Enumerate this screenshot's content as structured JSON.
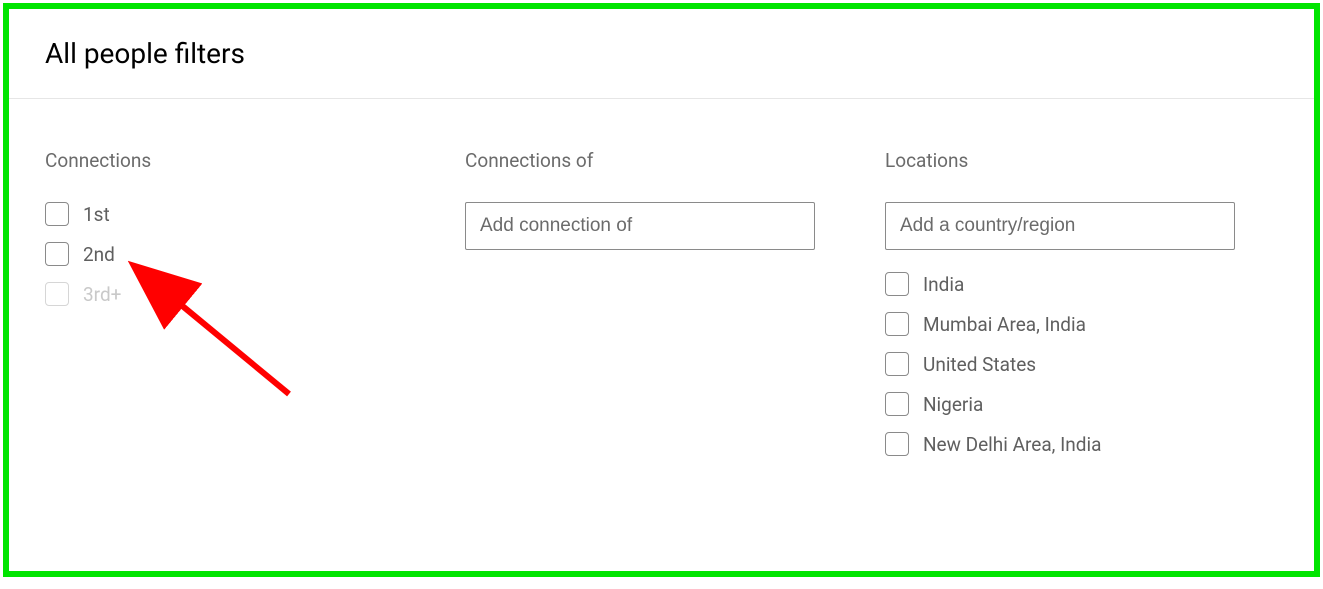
{
  "header": {
    "title": "All people filters"
  },
  "connections": {
    "label": "Connections",
    "items": [
      {
        "label": "1st",
        "disabled": false
      },
      {
        "label": "2nd",
        "disabled": false
      },
      {
        "label": "3rd+",
        "disabled": true
      }
    ]
  },
  "connections_of": {
    "label": "Connections of",
    "placeholder": "Add connection of"
  },
  "locations": {
    "label": "Locations",
    "placeholder": "Add a country/region",
    "items": [
      {
        "label": "India"
      },
      {
        "label": "Mumbai Area, India"
      },
      {
        "label": "United States"
      },
      {
        "label": "Nigeria"
      },
      {
        "label": "New Delhi Area, India"
      }
    ]
  }
}
